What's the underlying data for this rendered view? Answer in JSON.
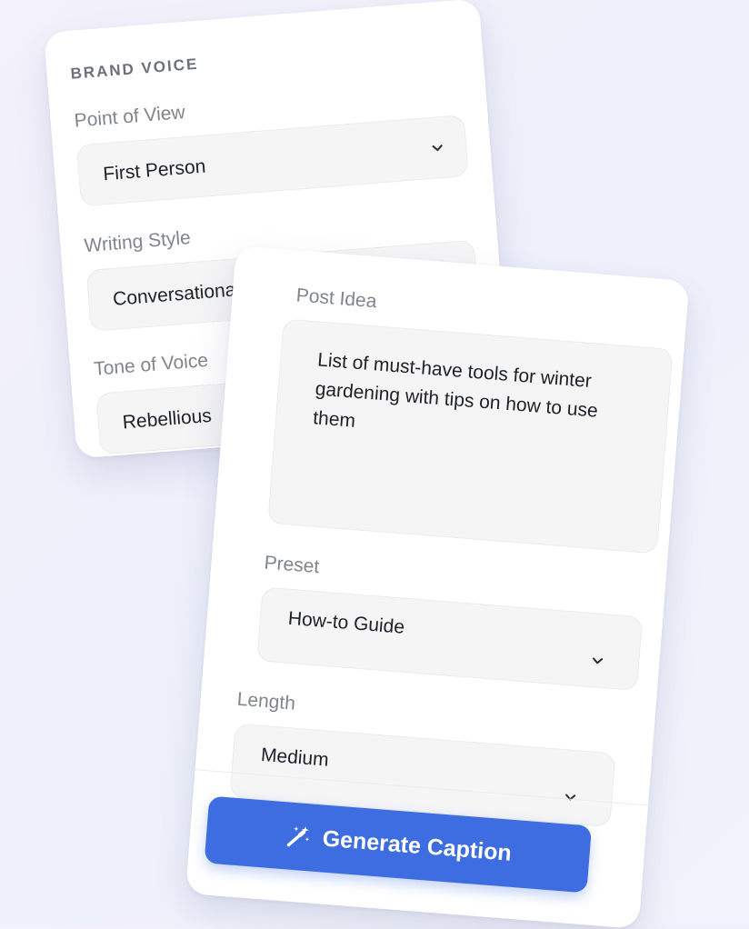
{
  "brand_voice": {
    "heading": "BRAND VOICE",
    "point_of_view": {
      "label": "Point of View",
      "value": "First Person"
    },
    "writing_style": {
      "label": "Writing Style",
      "value": "Conversational"
    },
    "tone_of_voice": {
      "label": "Tone of Voice",
      "value": "Rebellious"
    }
  },
  "post_form": {
    "post_idea": {
      "label": "Post Idea",
      "value": "List of must-have tools for winter gardening with tips on how to use them"
    },
    "preset": {
      "label": "Preset",
      "value": "How-to Guide"
    },
    "length": {
      "label": "Length",
      "value": "Medium"
    },
    "generate_button": {
      "label": "Generate Caption",
      "icon": "magic-wand-icon"
    }
  },
  "colors": {
    "accent": "#3d6de0",
    "card": "#ffffff",
    "field_bg": "#f5f5f6",
    "label_text": "#80858d"
  }
}
